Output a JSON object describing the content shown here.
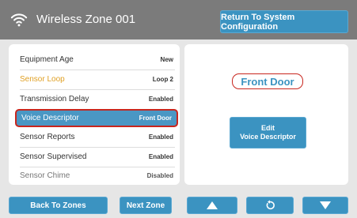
{
  "header": {
    "wifi_icon": "wifi-icon",
    "title": "Wireless Zone 001",
    "return_button": "Return To System Configuration"
  },
  "settings": [
    {
      "label": "Equipment Age",
      "value": "New"
    },
    {
      "label": "Sensor Loop",
      "value": "Loop 2"
    },
    {
      "label": "Transmission Delay",
      "value": "Enabled"
    },
    {
      "label": "Voice Descriptor",
      "value": "Front Door"
    },
    {
      "label": "Sensor Reports",
      "value": "Enabled"
    },
    {
      "label": "Sensor Supervised",
      "value": "Enabled"
    },
    {
      "label": "Sensor Chime",
      "value": "Disabled"
    }
  ],
  "detail": {
    "device_name": "Front Door",
    "edit_line1": "Edit",
    "edit_line2": "Voice Descriptor"
  },
  "footer": {
    "back_to_zones": "Back To Zones",
    "next_zone": "Next Zone",
    "up_icon": "up-arrow-icon",
    "undo_icon": "undo-icon",
    "down_icon": "down-arrow-icon"
  },
  "colors": {
    "accent": "#3b93c1",
    "selected_row": "#4a97c4",
    "highlight_outline": "#c8261e",
    "orange_label": "#e0a024",
    "header_bg": "#7b7b7b"
  }
}
